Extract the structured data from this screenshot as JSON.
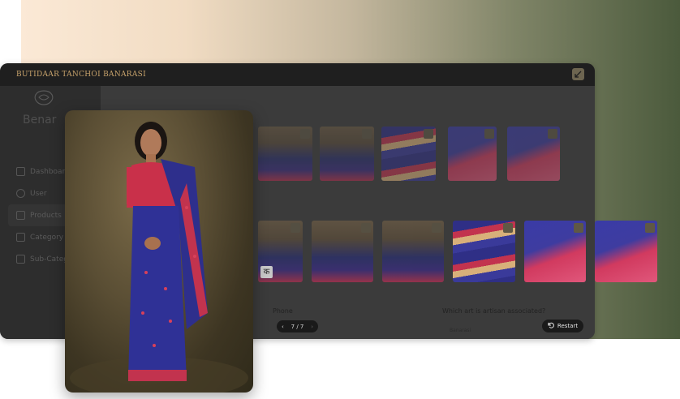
{
  "window": {
    "title": "BUTIDAAR TANCHOI BANARASI"
  },
  "sidebar": {
    "brand": "Benar",
    "items": [
      {
        "label": "Dashboard"
      },
      {
        "label": "User"
      },
      {
        "label": "Products"
      },
      {
        "label": "Category"
      },
      {
        "label": "Sub-Categ"
      }
    ]
  },
  "zoom": {
    "in_icon": "zoom-in-icon",
    "out_icon": "zoom-out-icon"
  },
  "form": {
    "phone_label": "Phone",
    "question_label": "Which art is artisan associated?",
    "answer_text": "Banarasi"
  },
  "pager": {
    "text": "7 / 7",
    "prev": "‹",
    "next": "›"
  },
  "restart": {
    "label": "Restart",
    "icon": "restart-icon"
  },
  "badge": {
    "text": "क"
  },
  "colors": {
    "title": "#c9a46c",
    "window_bg": "#3a3a3a",
    "titlebar_bg": "#1f1f1f",
    "saree_blue": "#2f2f86",
    "saree_red": "#c2334e"
  }
}
